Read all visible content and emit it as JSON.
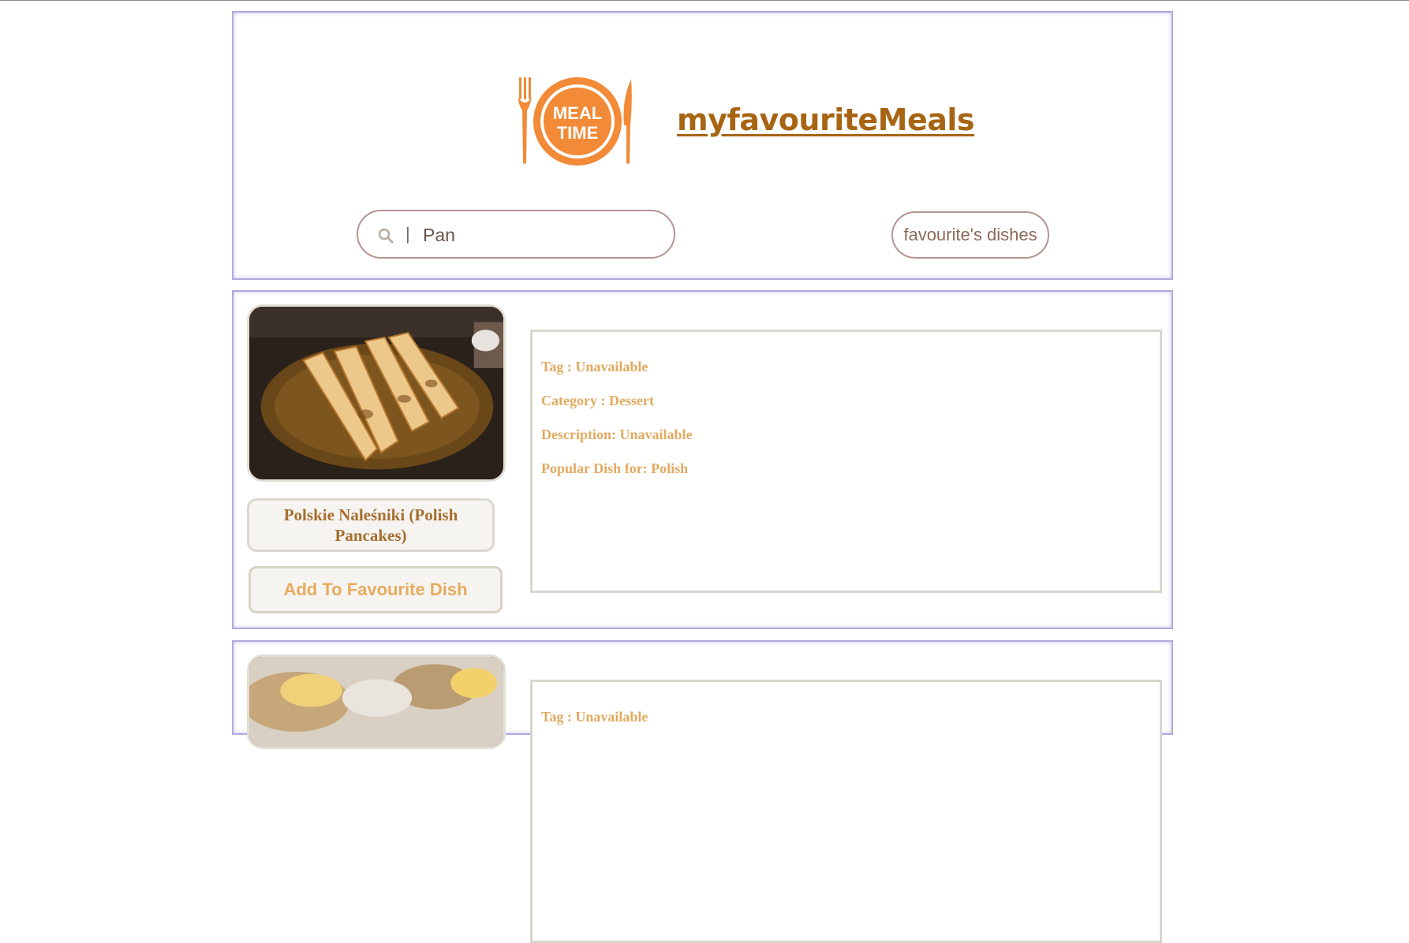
{
  "header": {
    "logo_text_line1": "MEAL",
    "logo_text_line2": "TIME",
    "site_title": "myfavouriteMeals",
    "search": {
      "separator": "|",
      "value": "Pan",
      "placeholder": ""
    },
    "favourites_button": "favourite's dishes"
  },
  "results": [
    {
      "name": "Polskie Naleśniki (Polish Pancakes)",
      "add_button": "Add To Favourite Dish",
      "tag": "Tag : Unavailable",
      "category": "Category : Dessert",
      "description": "Description: Unavailable",
      "popular": "Popular Dish for: Polish"
    },
    {
      "tag": "Tag : Unavailable"
    }
  ],
  "colors": {
    "brand_orange": "#f28a37",
    "title_brown": "#a76514",
    "info_text": "#e2aa60",
    "panel_border": "#b3a8dd"
  },
  "icons": {
    "logo": "meal-time-logo",
    "search": "search-icon"
  }
}
